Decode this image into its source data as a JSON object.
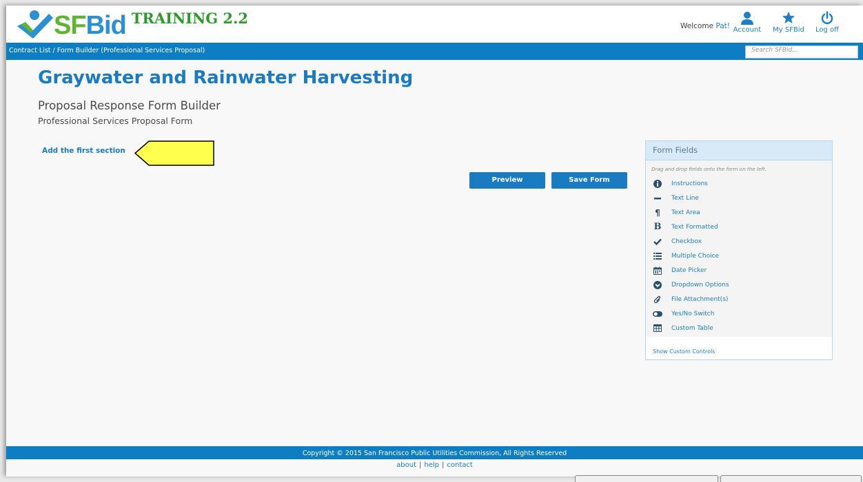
{
  "header": {
    "logo_sf": "SF",
    "logo_bid": "Bid",
    "training": "TRAINING 2.2",
    "welcome_prefix": "Welcome ",
    "user": "Pat!",
    "nav": {
      "account": "Account",
      "my_sfbid": "My SFBid",
      "logoff": "Log off"
    }
  },
  "breadcrumb": "Contract List / Form Builder (Professional Services Proposal)",
  "search": {
    "placeholder": "Search SFBid..."
  },
  "main": {
    "title": "Graywater and Rainwater Harvesting",
    "subtitle": "Proposal Response Form Builder",
    "form_name": "Professional Services Proposal Form",
    "add_section": "Add the first section",
    "preview": "Preview",
    "save": "Save Form"
  },
  "panel": {
    "title": "Form Fields",
    "hint": "Drag and drop fields onto the form on the left.",
    "fields": [
      {
        "label": "Instructions",
        "icon": "info-icon"
      },
      {
        "label": "Text Line",
        "icon": "minus-icon"
      },
      {
        "label": "Text Area",
        "icon": "paragraph-icon"
      },
      {
        "label": "Text Formatted",
        "icon": "bold-icon"
      },
      {
        "label": "Checkbox",
        "icon": "check-icon"
      },
      {
        "label": "Multiple Choice",
        "icon": "list-icon"
      },
      {
        "label": "Date Picker",
        "icon": "calendar-icon"
      },
      {
        "label": "Dropdown Options",
        "icon": "chevron-circle-down-icon"
      },
      {
        "label": "File Attachment(s)",
        "icon": "paperclip-icon"
      },
      {
        "label": "Yes/No Switch",
        "icon": "toggle-icon"
      },
      {
        "label": "Custom Table",
        "icon": "table-icon"
      }
    ],
    "show_custom": "Show Custom Controls"
  },
  "footer": {
    "copyright": "Copyright © 2015 San Francisco Public Utilities Commission, All Rights Reserved",
    "links": [
      "about",
      "help",
      "contact"
    ]
  },
  "colors": {
    "brand_blue": "#0d7ec4",
    "brand_green": "#5fb532",
    "link_blue": "#1b7bc2",
    "arrow_yellow": "#ffff4d"
  }
}
